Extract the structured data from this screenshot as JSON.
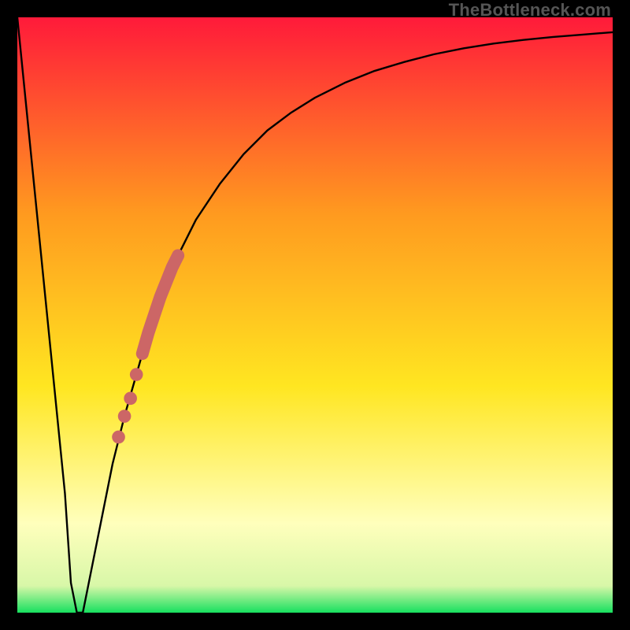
{
  "watermark": "TheBottleneck.com",
  "colors": {
    "frame": "#000000",
    "curve": "#000000",
    "markers": "#cc6666",
    "gradient_top": "#ff1a3a",
    "gradient_mid_upper": "#ff9a1f",
    "gradient_mid": "#ffe621",
    "gradient_lower": "#ffffbc",
    "gradient_bottom": "#17e05f"
  },
  "chart_data": {
    "type": "line",
    "title": "",
    "xlabel": "",
    "ylabel": "",
    "xlim": [
      0,
      100
    ],
    "ylim": [
      0,
      100
    ],
    "series": [
      {
        "name": "bottleneck-curve",
        "x": [
          0,
          2,
          4,
          6,
          8,
          9,
          10,
          11,
          12,
          14,
          16,
          18,
          20,
          22,
          24,
          26,
          28,
          30,
          34,
          38,
          42,
          46,
          50,
          55,
          60,
          65,
          70,
          75,
          80,
          85,
          90,
          95,
          100
        ],
        "y": [
          100,
          80,
          60,
          40,
          20,
          5,
          0,
          0,
          5,
          15,
          25,
          33,
          40,
          47,
          53,
          58,
          62,
          66,
          72,
          77,
          81,
          84,
          86.5,
          89,
          91,
          92.5,
          93.8,
          94.8,
          95.6,
          96.2,
          96.7,
          97.1,
          97.5
        ]
      }
    ],
    "markers": [
      {
        "name": "segment",
        "x_range": [
          21,
          27
        ],
        "y_range": [
          43,
          60
        ],
        "style": "thick"
      },
      {
        "name": "dot",
        "x": 20,
        "y": 40,
        "r": 1.1
      },
      {
        "name": "dot",
        "x": 19,
        "y": 36,
        "r": 1.1
      },
      {
        "name": "dot",
        "x": 18,
        "y": 33,
        "r": 1.1
      },
      {
        "name": "dot",
        "x": 17,
        "y": 29.5,
        "r": 1.1
      }
    ],
    "gradient_stops": [
      {
        "pos": 0.0,
        "color": "#ff1a3a"
      },
      {
        "pos": 0.33,
        "color": "#ff9a1f"
      },
      {
        "pos": 0.62,
        "color": "#ffe621"
      },
      {
        "pos": 0.85,
        "color": "#ffffbc"
      },
      {
        "pos": 0.955,
        "color": "#d8f7a8"
      },
      {
        "pos": 1.0,
        "color": "#17e05f"
      }
    ]
  }
}
